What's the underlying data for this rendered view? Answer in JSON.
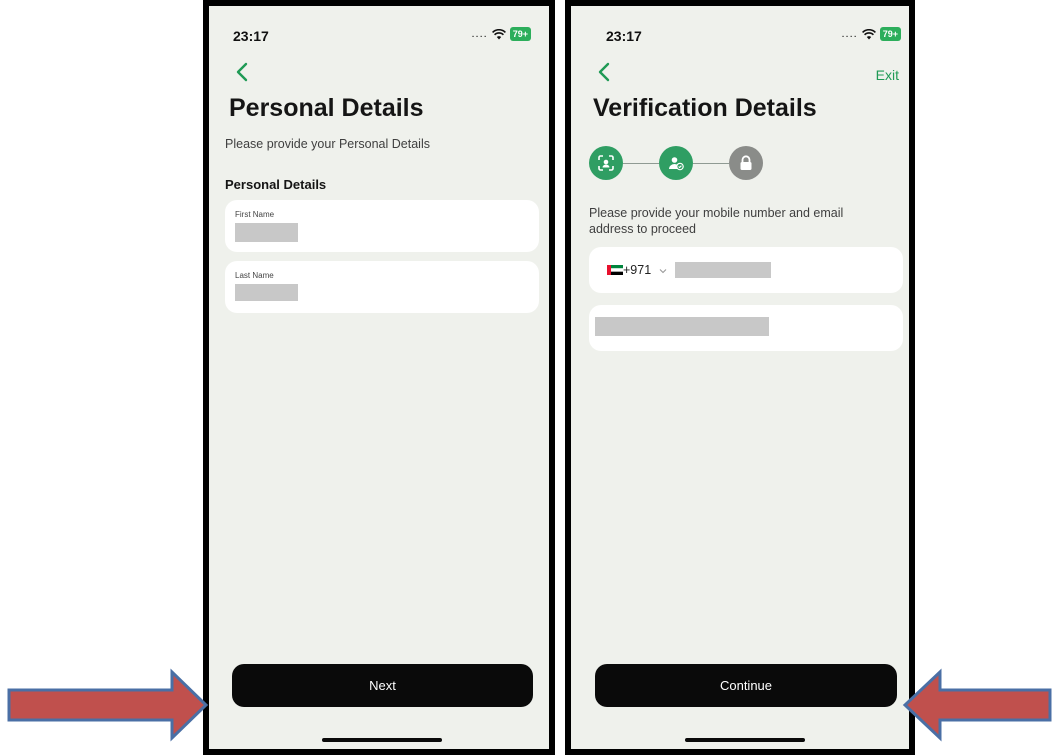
{
  "phone_left": {
    "status": {
      "time": "23:17",
      "signal": "....",
      "battery": "79+"
    },
    "title": "Personal Details",
    "subtitle": "Please provide your Personal Details",
    "section_label": "Personal Details",
    "fields": [
      {
        "label": "First Name",
        "value": "[redacted]"
      },
      {
        "label": "Last Name",
        "value": "[redacted]"
      }
    ],
    "next_label": "Next"
  },
  "phone_right": {
    "status": {
      "time": "23:17",
      "signal": "....",
      "battery": "79+"
    },
    "exit_label": "Exit",
    "title": "Verification Details",
    "steps": [
      {
        "icon": "face-scan-icon",
        "state": "completed"
      },
      {
        "icon": "user-check-icon",
        "state": "current"
      },
      {
        "icon": "lock-icon",
        "state": "pending"
      }
    ],
    "instructions": "Please provide your mobile number and email address to proceed",
    "phone_field": {
      "flag": "uae-flag-icon",
      "country_code": "+971",
      "number": "[redacted]"
    },
    "email_field": {
      "value": "[redacted]"
    },
    "continue_label": "Continue"
  },
  "colors": {
    "accent_green": "#2f9e63",
    "screen_bg": "#eff1ec",
    "arrow_red": "#c0504d",
    "arrow_border": "#4a6fa5",
    "button_black": "#0a0a0a"
  }
}
